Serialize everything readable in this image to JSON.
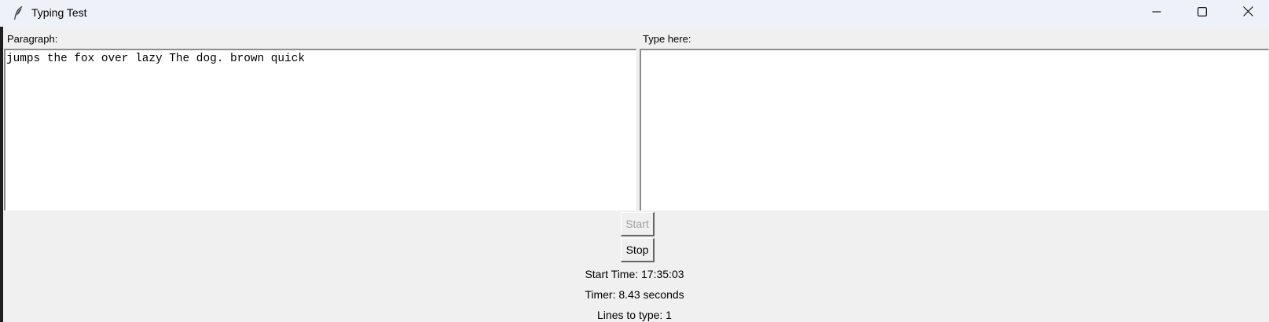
{
  "window": {
    "title": "Typing Test",
    "app_icon": "feather-icon",
    "controls": [
      "minimize-icon",
      "maximize-icon",
      "close-icon"
    ]
  },
  "paragraph": {
    "label": "Paragraph:",
    "text": "jumps the fox over lazy The dog. brown quick"
  },
  "typing": {
    "label": "Type here:",
    "value": ""
  },
  "buttons": {
    "start_label": "Start",
    "start_enabled": false,
    "stop_label": "Stop"
  },
  "status": {
    "start_time": "Start Time: 17:35:03",
    "timer": "Timer: 8.43 seconds",
    "lines_to_type": "Lines to type: 1"
  }
}
